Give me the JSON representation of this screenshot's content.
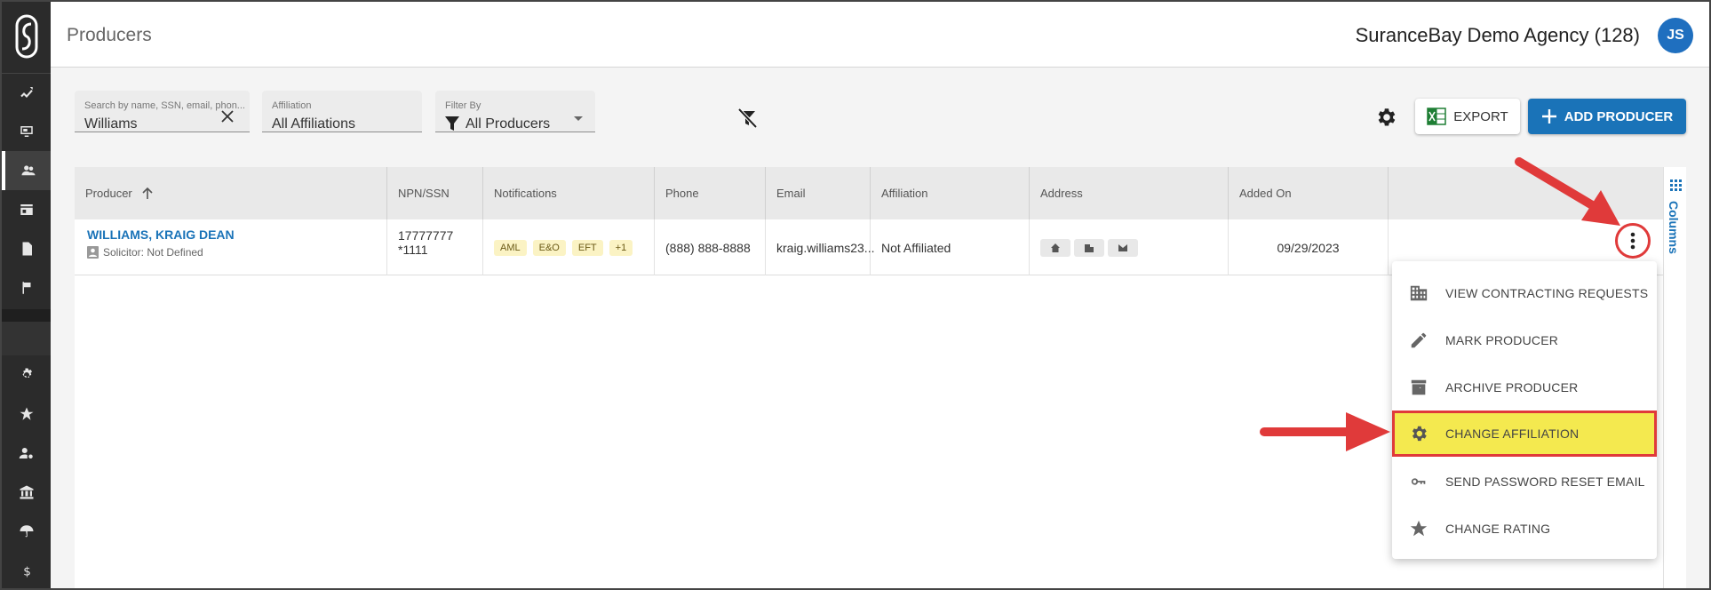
{
  "header": {
    "title": "Producers",
    "agency": "SuranceBay Demo Agency (128)",
    "avatar_initials": "JS"
  },
  "filters": {
    "search": {
      "placeholder": "Search by name, SSN, email, phon...",
      "value": "Williams"
    },
    "affiliation": {
      "label": "Affiliation",
      "value": "All Affiliations"
    },
    "filter_by": {
      "label": "Filter By",
      "value": "All Producers"
    }
  },
  "toolbar": {
    "export_label": "EXPORT",
    "add_label": "ADD PRODUCER"
  },
  "table": {
    "columns": [
      "Producer",
      "NPN/SSN",
      "Notifications",
      "Phone",
      "Email",
      "Affiliation",
      "Address",
      "Added On"
    ],
    "rows": [
      {
        "producer": "WILLIAMS, KRAIG DEAN",
        "solicitor": "Solicitor: Not Defined",
        "npn": "17777777",
        "ssn": "*1111",
        "notifications": [
          "AML",
          "E&O",
          "EFT",
          "+1"
        ],
        "phone": "(888) 888-8888",
        "email": "kraig.williams23...",
        "affiliation": "Not Affiliated",
        "added_on": "09/29/2023"
      }
    ]
  },
  "columns_panel_label": "Columns",
  "row_menu": {
    "items": [
      {
        "label": "VIEW CONTRACTING REQUESTS",
        "icon": "building-icon"
      },
      {
        "label": "MARK PRODUCER",
        "icon": "pencil-icon"
      },
      {
        "label": "ARCHIVE PRODUCER",
        "icon": "archive-icon"
      },
      {
        "label": "CHANGE AFFILIATION",
        "icon": "gear-icon"
      },
      {
        "label": "SEND PASSWORD RESET EMAIL",
        "icon": "key-icon"
      },
      {
        "label": "CHANGE RATING",
        "icon": "star-icon"
      }
    ],
    "highlighted": "CHANGE AFFILIATION"
  },
  "colors": {
    "accent": "#1a73b8",
    "sidebar": "#2b2b2b",
    "highlight": "#f4e94f",
    "annotation": "#e03a3a",
    "badge": "#fbf3c4"
  }
}
